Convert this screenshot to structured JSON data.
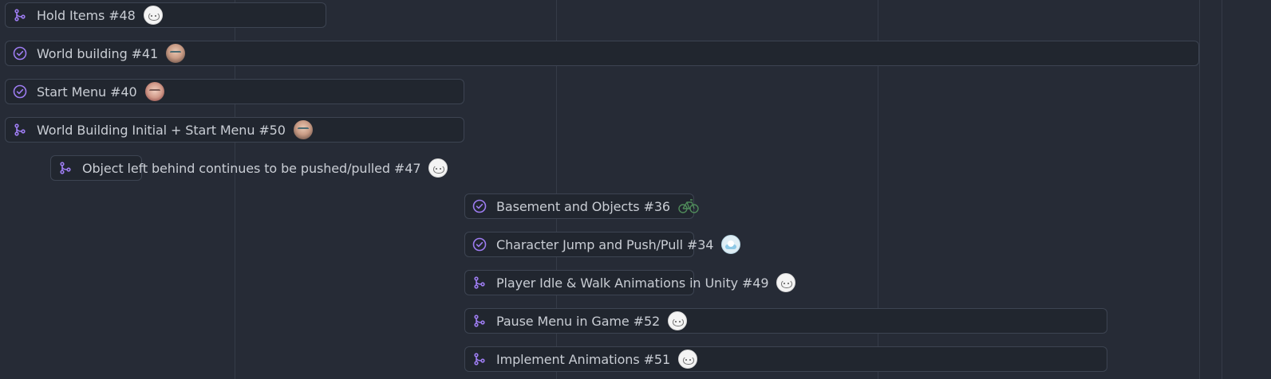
{
  "accent_color": "#9d7cf0",
  "items": [
    {
      "title": "Hold Items #48",
      "icon": "pull-request-icon",
      "avatar": "cat-avatar"
    },
    {
      "title": "World building #41",
      "icon": "closed-check-icon",
      "avatar": "person-avatar"
    },
    {
      "title": "Start Menu #40",
      "icon": "closed-check-icon",
      "avatar": "person-avatar-alt"
    },
    {
      "title": "World Building Initial + Start Menu #50",
      "icon": "pull-request-icon",
      "avatar": "person-avatar"
    },
    {
      "title": "Object left behind continues to be pushed/pulled #47",
      "icon": "pull-request-icon",
      "avatar": "cat-avatar"
    },
    {
      "title": "Basement and Objects #36",
      "icon": "closed-check-icon",
      "avatar": "bike-avatar"
    },
    {
      "title": "Character Jump and Push/Pull #34",
      "icon": "closed-check-icon",
      "avatar": "cloud-avatar"
    },
    {
      "title": "Player Idle & Walk Animations in Unity #49",
      "icon": "pull-request-icon",
      "avatar": "cat-avatar"
    },
    {
      "title": "Pause Menu in Game #52",
      "icon": "pull-request-icon",
      "avatar": "cat-avatar"
    },
    {
      "title": "Implement Animations #51",
      "icon": "pull-request-icon",
      "avatar": "cat-avatar"
    }
  ]
}
